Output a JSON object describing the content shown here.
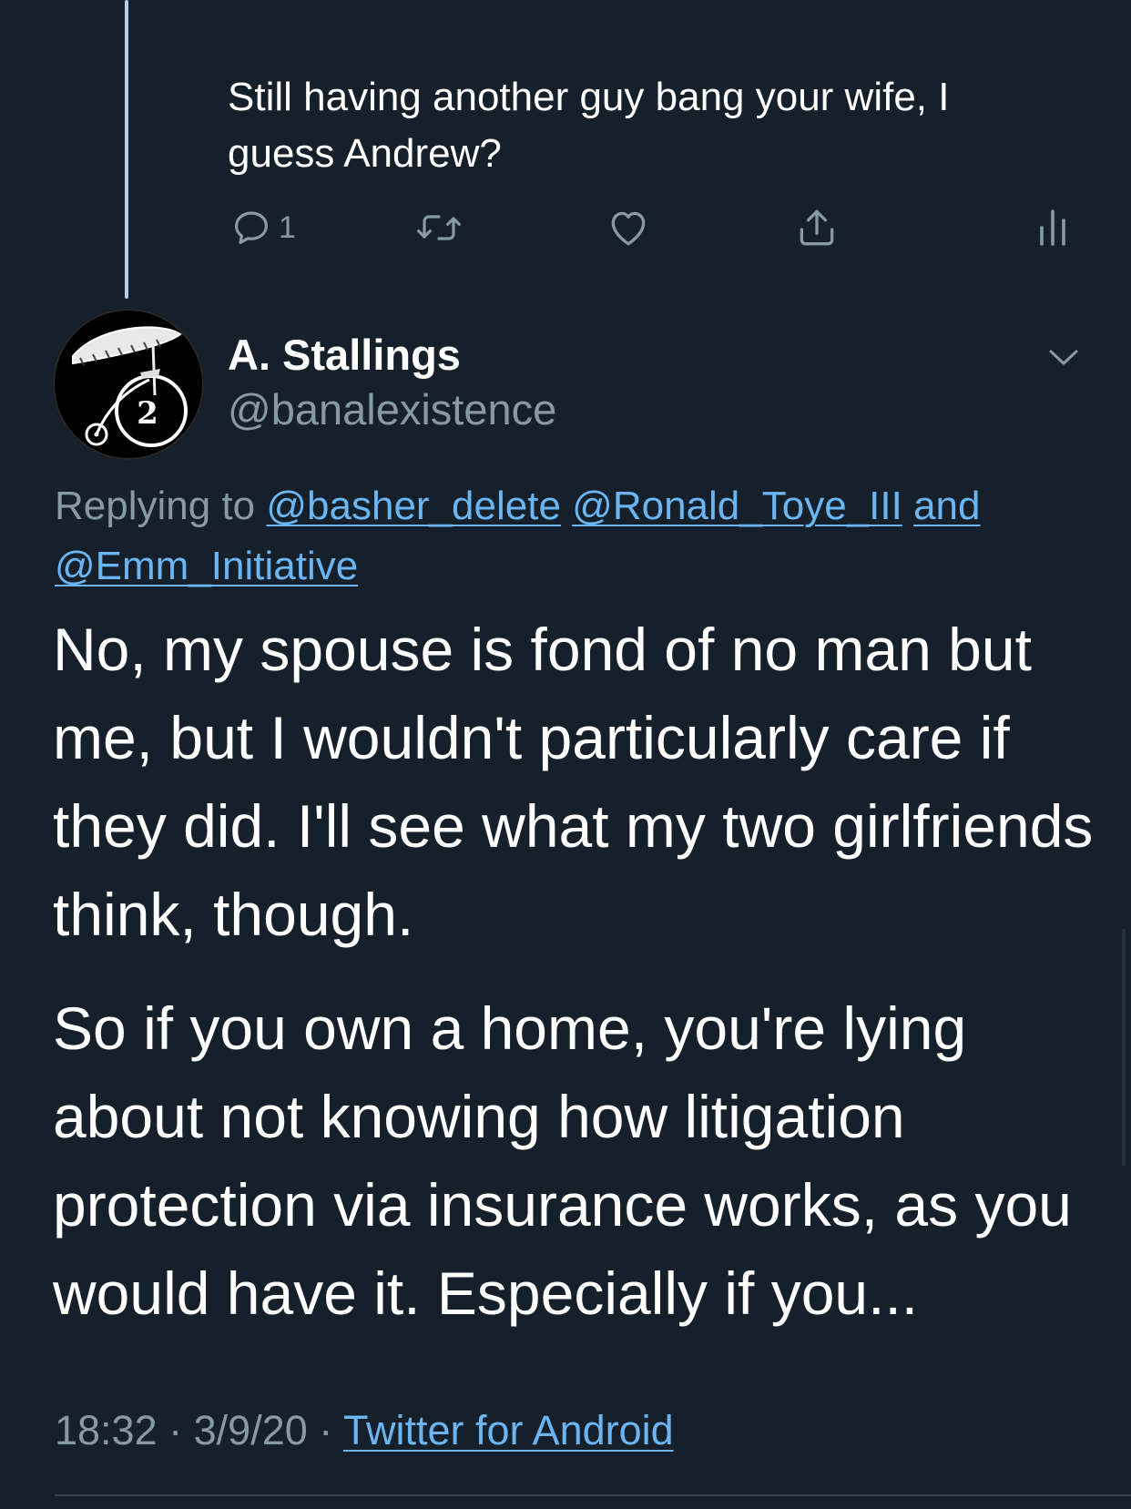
{
  "parent_tweet": {
    "text": "Still having another guy bang your wife, I guess Andrew?",
    "actions": {
      "reply_count": "1",
      "reply_icon": "comment-icon",
      "retweet_icon": "retweet-icon",
      "like_icon": "heart-icon",
      "share_icon": "share-icon",
      "analytics_icon": "analytics-icon"
    }
  },
  "tweet": {
    "display_name": "A. Stallings",
    "handle": "@banalexistence",
    "avatar_number": "2",
    "menu_icon": "chevron-down-icon",
    "replying_prefix": "Replying to",
    "replying_to": {
      "mention_1": "@basher_delete",
      "mention_2": "@Ronald_Toye_III",
      "joiner": "and",
      "mention_3": "@Emm_Initiative"
    },
    "paragraphs": [
      "No, my spouse is fond of no man but me, but I wouldn't particularly care if they did. I'll see what my two girlfriends think, though.",
      "So if you own a home, you're lying about not knowing how litigation protection via insurance works, as you would have it. Especially if you..."
    ],
    "time": "18:32",
    "separator": "·",
    "date": "3/9/20",
    "source": "Twitter for Android"
  },
  "colors": {
    "background": "#15202b",
    "text_primary": "#ffffff",
    "text_secondary": "#8899a6",
    "link": "#6bb6f2",
    "thread_line": "#b8cbe8",
    "divider": "#38444d"
  }
}
